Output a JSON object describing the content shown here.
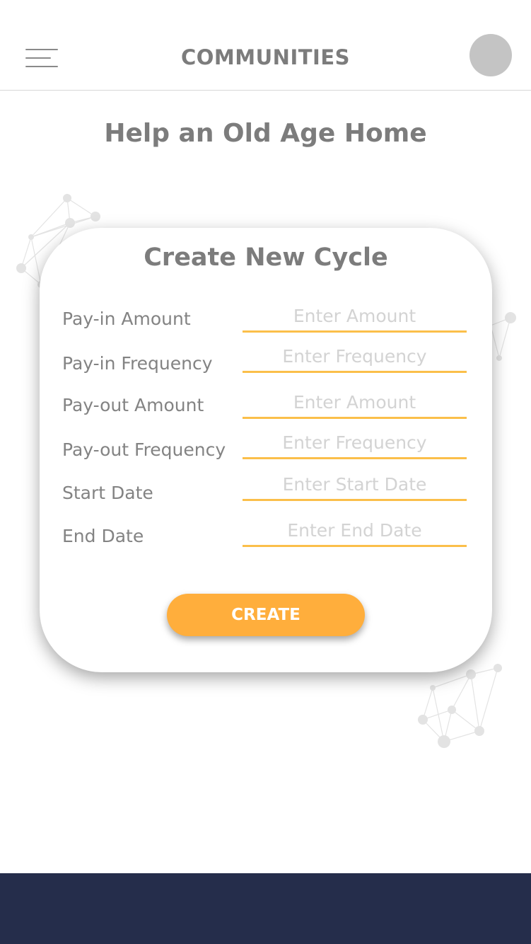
{
  "header": {
    "title": "COMMUNITIES"
  },
  "page": {
    "title": "Help an Old Age Home"
  },
  "form": {
    "title": "Create New Cycle",
    "fields": [
      {
        "label": "Pay-in Amount",
        "placeholder": "Enter Amount",
        "value": ""
      },
      {
        "label": "Pay-in Frequency",
        "placeholder": "Enter Frequency",
        "value": ""
      },
      {
        "label": "Pay-out Amount",
        "placeholder": "Enter Amount",
        "value": ""
      },
      {
        "label": "Pay-out Frequency",
        "placeholder": "Enter Frequency",
        "value": ""
      },
      {
        "label": "Start Date",
        "placeholder": "Enter Start Date",
        "value": ""
      },
      {
        "label": "End Date",
        "placeholder": "Enter End Date",
        "value": ""
      }
    ],
    "submit_label": "CREATE"
  },
  "icons": {
    "menu": "hamburger-menu-icon",
    "avatar": "user-avatar",
    "decoration": "network-graph-icon"
  },
  "colors": {
    "accent": "#ffae3c",
    "input_underline": "#fbbf4a",
    "text": "#7c7c7c",
    "footer": "#252d4b",
    "avatar": "#c4c4c4"
  }
}
